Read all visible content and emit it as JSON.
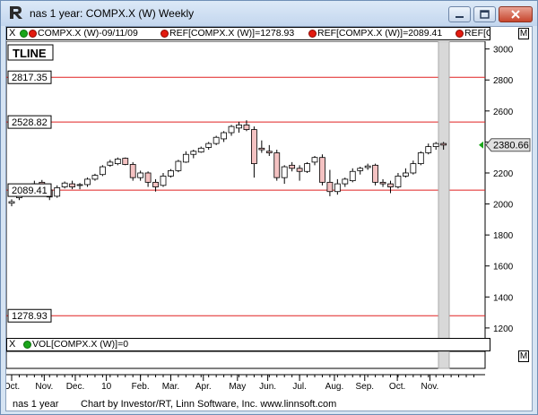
{
  "window": {
    "title": "nas 1 year: COMPX.X (W) Weekly"
  },
  "legend": {
    "close_symbol": "X",
    "item1": "COMPX.X (W)-09/11/09",
    "item2": "REF[COMPX.X (W)]=1278.93",
    "item3": "REF[COMPX.X (W)]=2089.41",
    "item4": "REF[COMPX.X",
    "m_button": "M"
  },
  "tline_label": "TLINE",
  "ref_labels": [
    "2817.35",
    "2528.82",
    "2089.41",
    "1278.93"
  ],
  "last_price_label": "2380.66",
  "volume_legend": {
    "close_symbol": "X",
    "text": "VOL[COMPX.X (W)]=0",
    "m_button": "M"
  },
  "status": {
    "left": "nas 1 year",
    "right": "Chart by Investor/RT, Linn Software, Inc. www.linnsoft.com"
  },
  "chart_data": {
    "type": "candlestick",
    "y_ticks": [
      1200,
      1400,
      1600,
      1800,
      2000,
      2200,
      2400,
      2600,
      2800,
      3000
    ],
    "ylim": [
      1130,
      3050
    ],
    "x_labels": [
      "Oct.",
      "Nov.",
      "Dec.",
      "10",
      "Feb.",
      "Mar.",
      "Apr.",
      "May",
      "Jun.",
      "Jul.",
      "Aug.",
      "Sep.",
      "Oct.",
      "Nov."
    ],
    "x_label_positions": [
      0.0,
      4.3,
      8.4,
      12.5,
      17.0,
      21.0,
      25.3,
      29.8,
      33.8,
      38.0,
      42.6,
      46.6,
      50.9,
      55.2
    ],
    "ref_lines": [
      2817.35,
      2528.82,
      2089.41,
      1278.93
    ],
    "last_price": 2380.66,
    "colors": {
      "up": "#ffffff",
      "down": "#f4c2c2",
      "ref_line": "#e02020",
      "last_price": "#1aa51a"
    },
    "candles": [
      {
        "o": 2005,
        "h": 2030,
        "l": 1985,
        "c": 2015
      },
      {
        "o": 2040,
        "h": 2100,
        "l": 2025,
        "c": 2090
      },
      {
        "o": 2085,
        "h": 2120,
        "l": 2070,
        "c": 2110
      },
      {
        "o": 2110,
        "h": 2150,
        "l": 2090,
        "c": 2130
      },
      {
        "o": 2140,
        "h": 2155,
        "l": 2095,
        "c": 2125
      },
      {
        "o": 2090,
        "h": 2110,
        "l": 2025,
        "c": 2045
      },
      {
        "o": 2050,
        "h": 2120,
        "l": 2040,
        "c": 2105
      },
      {
        "o": 2110,
        "h": 2145,
        "l": 2100,
        "c": 2135
      },
      {
        "o": 2130,
        "h": 2150,
        "l": 2095,
        "c": 2110
      },
      {
        "o": 2120,
        "h": 2135,
        "l": 2095,
        "c": 2125
      },
      {
        "o": 2125,
        "h": 2170,
        "l": 2110,
        "c": 2160
      },
      {
        "o": 2160,
        "h": 2195,
        "l": 2150,
        "c": 2185
      },
      {
        "o": 2190,
        "h": 2250,
        "l": 2180,
        "c": 2240
      },
      {
        "o": 2250,
        "h": 2285,
        "l": 2240,
        "c": 2270
      },
      {
        "o": 2260,
        "h": 2300,
        "l": 2250,
        "c": 2290
      },
      {
        "o": 2295,
        "h": 2300,
        "l": 2250,
        "c": 2255
      },
      {
        "o": 2255,
        "h": 2270,
        "l": 2150,
        "c": 2170
      },
      {
        "o": 2170,
        "h": 2215,
        "l": 2150,
        "c": 2200
      },
      {
        "o": 2200,
        "h": 2210,
        "l": 2110,
        "c": 2140
      },
      {
        "o": 2140,
        "h": 2160,
        "l": 2080,
        "c": 2110
      },
      {
        "o": 2120,
        "h": 2200,
        "l": 2110,
        "c": 2180
      },
      {
        "o": 2180,
        "h": 2225,
        "l": 2170,
        "c": 2215
      },
      {
        "o": 2215,
        "h": 2285,
        "l": 2205,
        "c": 2275
      },
      {
        "o": 2270,
        "h": 2340,
        "l": 2265,
        "c": 2320
      },
      {
        "o": 2320,
        "h": 2350,
        "l": 2295,
        "c": 2340
      },
      {
        "o": 2335,
        "h": 2370,
        "l": 2330,
        "c": 2360
      },
      {
        "o": 2365,
        "h": 2400,
        "l": 2350,
        "c": 2390
      },
      {
        "o": 2390,
        "h": 2440,
        "l": 2380,
        "c": 2430
      },
      {
        "o": 2420,
        "h": 2470,
        "l": 2400,
        "c": 2460
      },
      {
        "o": 2460,
        "h": 2510,
        "l": 2440,
        "c": 2500
      },
      {
        "o": 2490,
        "h": 2530,
        "l": 2460,
        "c": 2510
      },
      {
        "o": 2510,
        "h": 2540,
        "l": 2470,
        "c": 2480
      },
      {
        "o": 2480,
        "h": 2500,
        "l": 2170,
        "c": 2260
      },
      {
        "o": 2360,
        "h": 2410,
        "l": 2330,
        "c": 2350
      },
      {
        "o": 2340,
        "h": 2380,
        "l": 2310,
        "c": 2330
      },
      {
        "o": 2330,
        "h": 2350,
        "l": 2150,
        "c": 2170
      },
      {
        "o": 2170,
        "h": 2250,
        "l": 2130,
        "c": 2240
      },
      {
        "o": 2250,
        "h": 2270,
        "l": 2210,
        "c": 2230
      },
      {
        "o": 2230,
        "h": 2250,
        "l": 2150,
        "c": 2210
      },
      {
        "o": 2210,
        "h": 2270,
        "l": 2200,
        "c": 2260
      },
      {
        "o": 2270,
        "h": 2310,
        "l": 2250,
        "c": 2300
      },
      {
        "o": 2300,
        "h": 2320,
        "l": 2120,
        "c": 2140
      },
      {
        "o": 2140,
        "h": 2220,
        "l": 2050,
        "c": 2080
      },
      {
        "o": 2080,
        "h": 2160,
        "l": 2060,
        "c": 2130
      },
      {
        "o": 2130,
        "h": 2170,
        "l": 2110,
        "c": 2160
      },
      {
        "o": 2150,
        "h": 2230,
        "l": 2140,
        "c": 2210
      },
      {
        "o": 2215,
        "h": 2240,
        "l": 2190,
        "c": 2230
      },
      {
        "o": 2235,
        "h": 2260,
        "l": 2220,
        "c": 2245
      },
      {
        "o": 2250,
        "h": 2260,
        "l": 2120,
        "c": 2140
      },
      {
        "o": 2140,
        "h": 2160,
        "l": 2110,
        "c": 2130
      },
      {
        "o": 2130,
        "h": 2150,
        "l": 2070,
        "c": 2110
      },
      {
        "o": 2110,
        "h": 2200,
        "l": 2100,
        "c": 2180
      },
      {
        "o": 2180,
        "h": 2230,
        "l": 2170,
        "c": 2200
      },
      {
        "o": 2200,
        "h": 2280,
        "l": 2190,
        "c": 2260
      },
      {
        "o": 2260,
        "h": 2340,
        "l": 2250,
        "c": 2330
      },
      {
        "o": 2330,
        "h": 2390,
        "l": 2320,
        "c": 2370
      },
      {
        "o": 2370,
        "h": 2400,
        "l": 2350,
        "c": 2390
      },
      {
        "o": 2390,
        "h": 2400,
        "l": 2350,
        "c": 2380
      }
    ]
  }
}
